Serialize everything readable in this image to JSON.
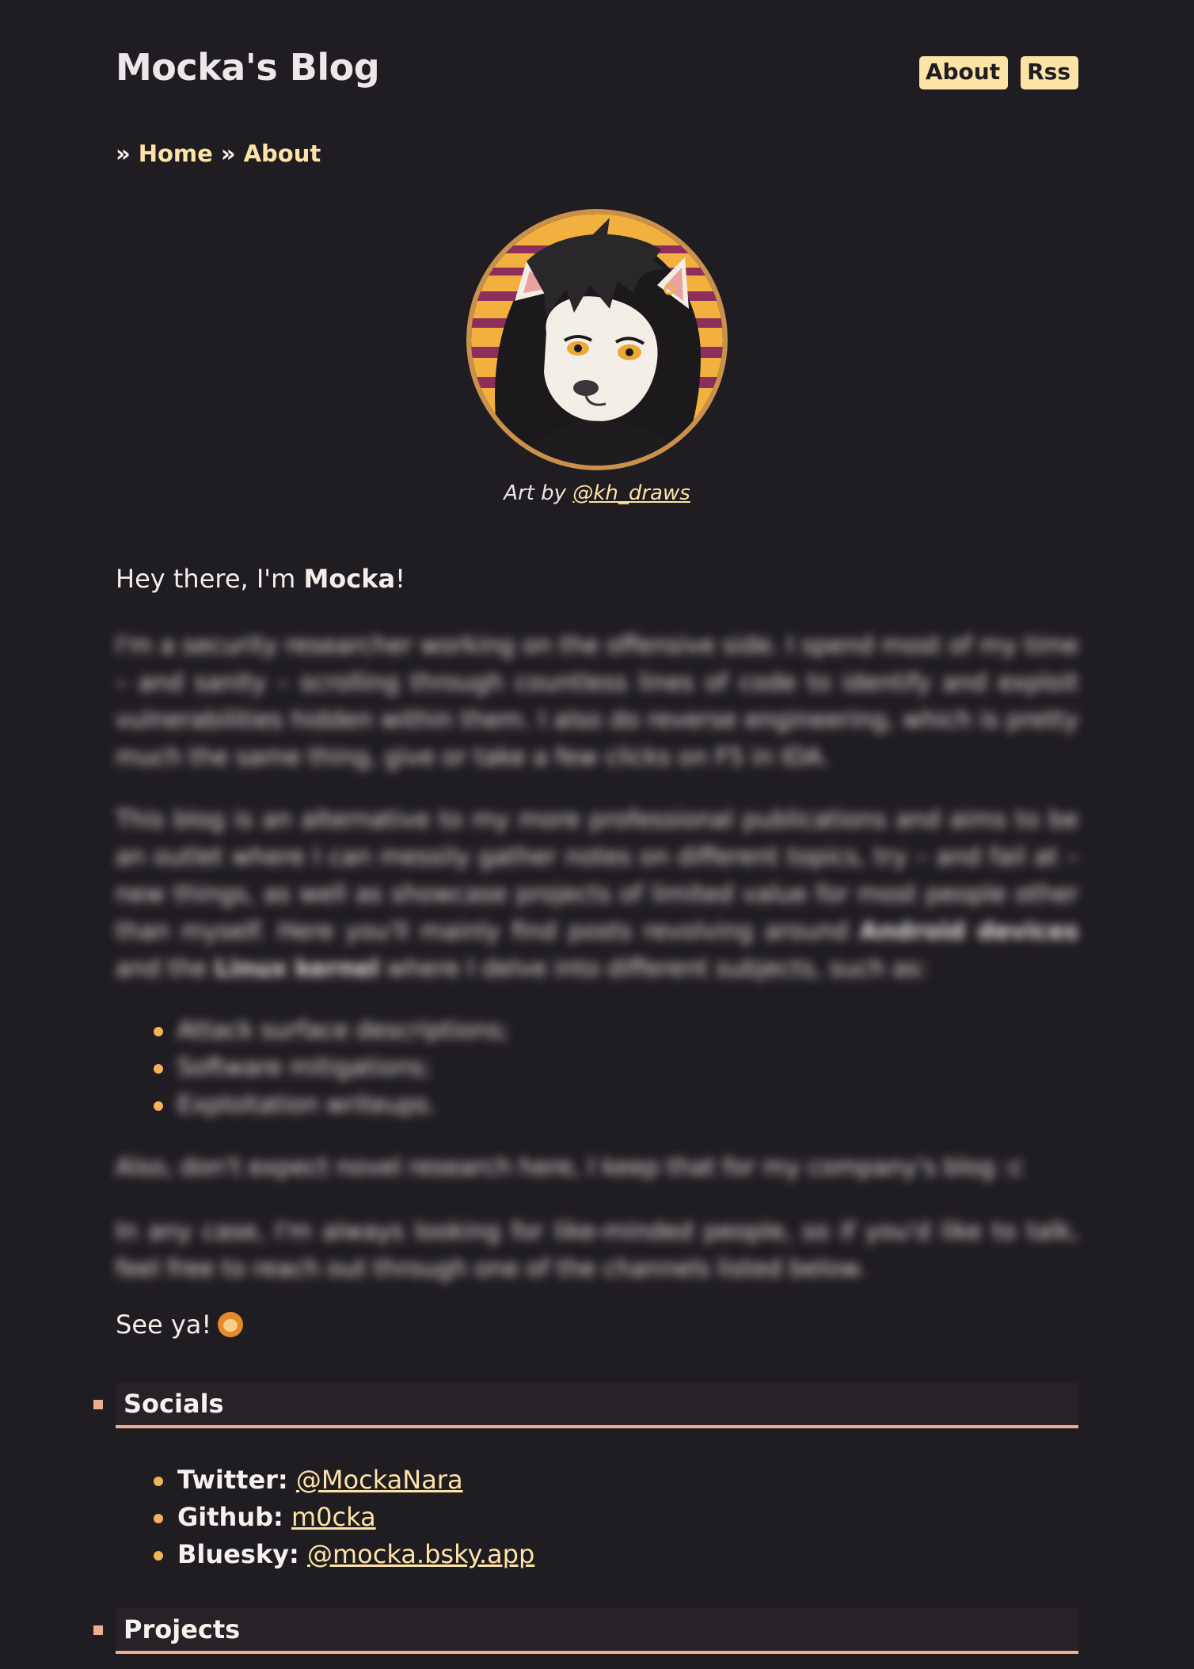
{
  "header": {
    "site_title": "Mocka's Blog",
    "nav": [
      {
        "label": "About"
      },
      {
        "label": "Rss"
      }
    ]
  },
  "breadcrumb": {
    "separator": "»",
    "items": [
      {
        "label": "Home"
      },
      {
        "label": "About"
      }
    ]
  },
  "avatar": {
    "caption_prefix": "Art by ",
    "caption_link": "@kh_draws"
  },
  "content": {
    "intro_prefix": "Hey there, I'm ",
    "intro_name": "Mocka",
    "intro_suffix": "!",
    "paragraph_1": "I'm a security researcher working on the offensive side. I spend most of my time – and sanity – scrolling through countless lines of code to identify and exploit vulnerabilities hidden within them. I also do reverse engineering, which is pretty much the same thing, give or take a few clicks on F5 in IDA.",
    "paragraph_2_a": "This blog is an alternative to my more professional publications and aims to be an outlet where I can messily gather notes on different topics, try – and fail at – new things, as well as showcase projects of limited value for most people other than myself. Here you'll mainly find posts revolving around ",
    "paragraph_2_b": "Android devices",
    "paragraph_2_c": " and the ",
    "paragraph_2_d": "Linux kernel",
    "paragraph_2_e": " where I delve into different subjects, such as:",
    "topics": [
      "Attack surface descriptions;",
      "Software mitigations;",
      "Exploitation writeups."
    ],
    "paragraph_3": "Also, don't expect novel research here, I keep that for my company's blog :c",
    "paragraph_4": "In any case, I'm always looking for like-minded people, so if you'd like to talk, feel free to reach out through one of the channels listed below.",
    "outro": "See ya!"
  },
  "sections": {
    "socials_title": "Socials",
    "projects_title": "Projects"
  },
  "socials": [
    {
      "label": "Twitter:",
      "value": "@MockaNara"
    },
    {
      "label": "Github:",
      "value": "m0cka"
    },
    {
      "label": "Bluesky:",
      "value": "@mocka.bsky.app"
    }
  ],
  "colors": {
    "background": "#201d22",
    "accent": "#fce3a6",
    "bullet": "#f4b35a",
    "section_underline": "#f0ab91",
    "avatar_ring": "#c9914c"
  },
  "icons": {
    "avatar": "lion-character-avatar",
    "outro_emoji": "lion-face-emoji"
  }
}
